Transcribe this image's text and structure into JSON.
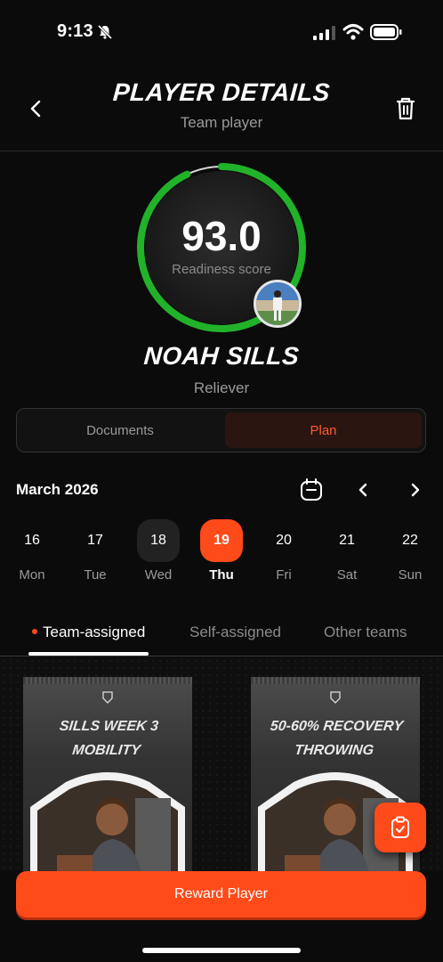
{
  "status_bar": {
    "time": "9:13"
  },
  "header": {
    "title": "PLAYER DETAILS",
    "subtitle": "Team player"
  },
  "score": {
    "value": "93.0",
    "label": "Readiness score",
    "progress": 0.93,
    "ring_color": "#22b22a"
  },
  "player": {
    "name": "NOAH SILLS",
    "role": "Reliever"
  },
  "segments": {
    "documents": "Documents",
    "plan": "Plan",
    "selected": "Plan"
  },
  "calendar": {
    "month": "March 2026",
    "days": [
      {
        "num": "16",
        "name": "Mon"
      },
      {
        "num": "17",
        "name": "Tue"
      },
      {
        "num": "18",
        "name": "Wed"
      },
      {
        "num": "19",
        "name": "Thu"
      },
      {
        "num": "20",
        "name": "Fri"
      },
      {
        "num": "21",
        "name": "Sat"
      },
      {
        "num": "22",
        "name": "Sun"
      }
    ],
    "selected_day": "19"
  },
  "tabs": {
    "team": "Team-assigned",
    "self": "Self-assigned",
    "other": "Other teams",
    "selected": "Team-assigned"
  },
  "plans": [
    {
      "line1": "SILLS WEEK 3",
      "line2": "MOBILITY"
    },
    {
      "line1": "50-60% RECOVERY",
      "line2": "THROWING"
    }
  ],
  "reward_button": "Reward Player",
  "colors": {
    "accent": "#ff4a1a",
    "background": "#0b0b0b"
  }
}
